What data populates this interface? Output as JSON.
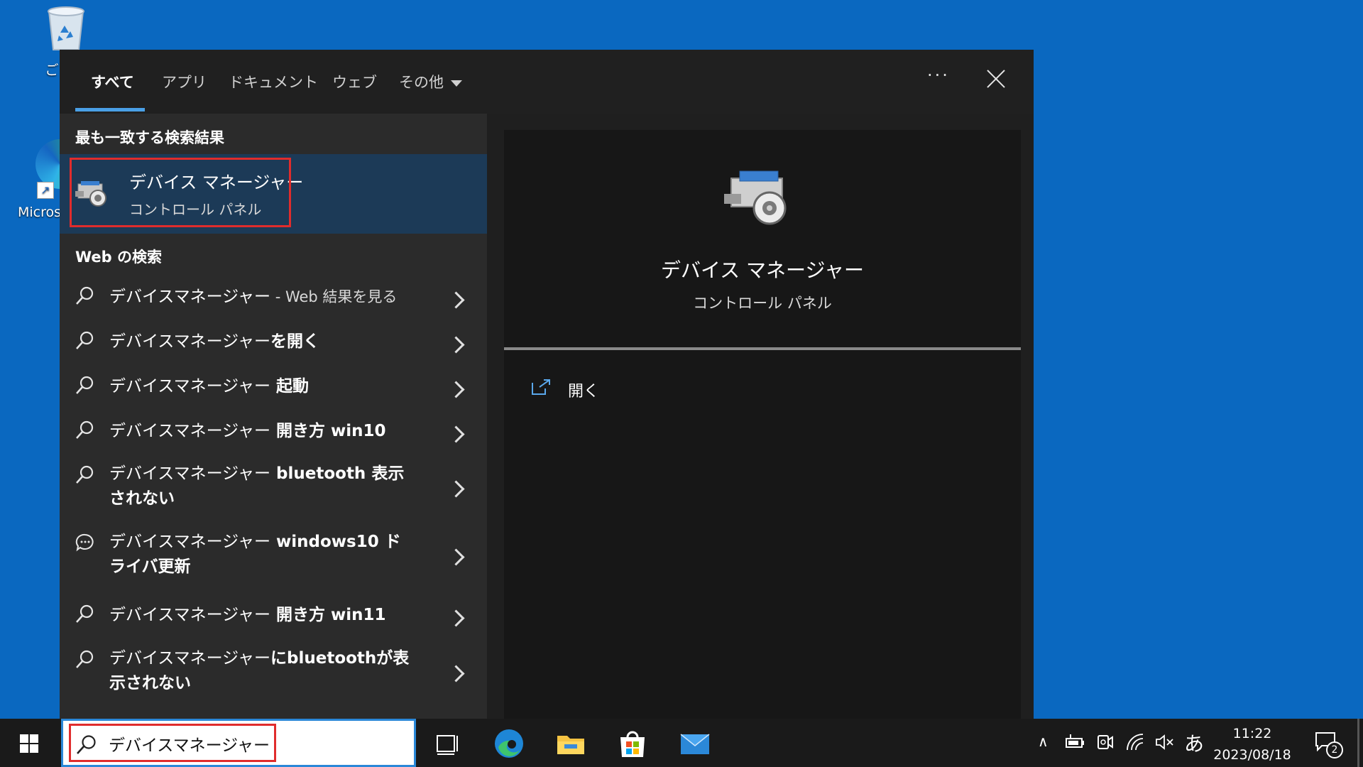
{
  "desktop": {
    "recycle_label": "ご",
    "edge_label": "Micros"
  },
  "tabs": [
    {
      "label": "すべて"
    },
    {
      "label": "アプリ"
    },
    {
      "label": "ドキュメント"
    },
    {
      "label": "ウェブ"
    },
    {
      "label": "その他"
    }
  ],
  "more_label": "···",
  "best_match": {
    "heading": "最も一致する検索結果",
    "title": "デバイス マネージャー",
    "subtitle": "コントロール パネル"
  },
  "web_search": {
    "heading": "Web の検索",
    "items": [
      {
        "prefix": "デバイスマネージャー",
        "suffix": " - Web 結果を見る",
        "bold": false,
        "icon": "search-icon"
      },
      {
        "prefix": "デバイスマネージャー",
        "suffix": "を開く",
        "bold": true,
        "icon": "search-icon"
      },
      {
        "prefix": "デバイスマネージャー",
        "suffix": " 起動",
        "bold": true,
        "icon": "search-icon"
      },
      {
        "prefix": "デバイスマネージャー",
        "suffix": " 開き方 win10",
        "bold": true,
        "icon": "search-icon"
      },
      {
        "prefix": "デバイスマネージャー",
        "suffix": " bluetooth 表示されない",
        "bold": true,
        "icon": "search-icon"
      },
      {
        "prefix": "デバイスマネージャー",
        "suffix": " windows10 ドライバ更新",
        "bold": true,
        "icon": "chat-icon"
      },
      {
        "prefix": "デバイスマネージャー",
        "suffix": " 開き方 win11",
        "bold": true,
        "icon": "search-icon"
      },
      {
        "prefix": "デバイスマネージャー",
        "suffix": "にbluetoothが表示されない",
        "bold": true,
        "icon": "search-icon"
      }
    ]
  },
  "preview": {
    "title": "デバイス マネージャー",
    "subtitle": "コントロール パネル",
    "action_open": "開く"
  },
  "taskbar": {
    "search_value": "デバイスマネージャー",
    "ime": "あ",
    "time": "11:22",
    "date": "2023/08/18",
    "notification_count": "2"
  },
  "colors": {
    "desktop": "#0a68c0",
    "accent": "#4aa0e6",
    "highlight": "#e02c2c",
    "selected_row": "#1c3a57"
  }
}
